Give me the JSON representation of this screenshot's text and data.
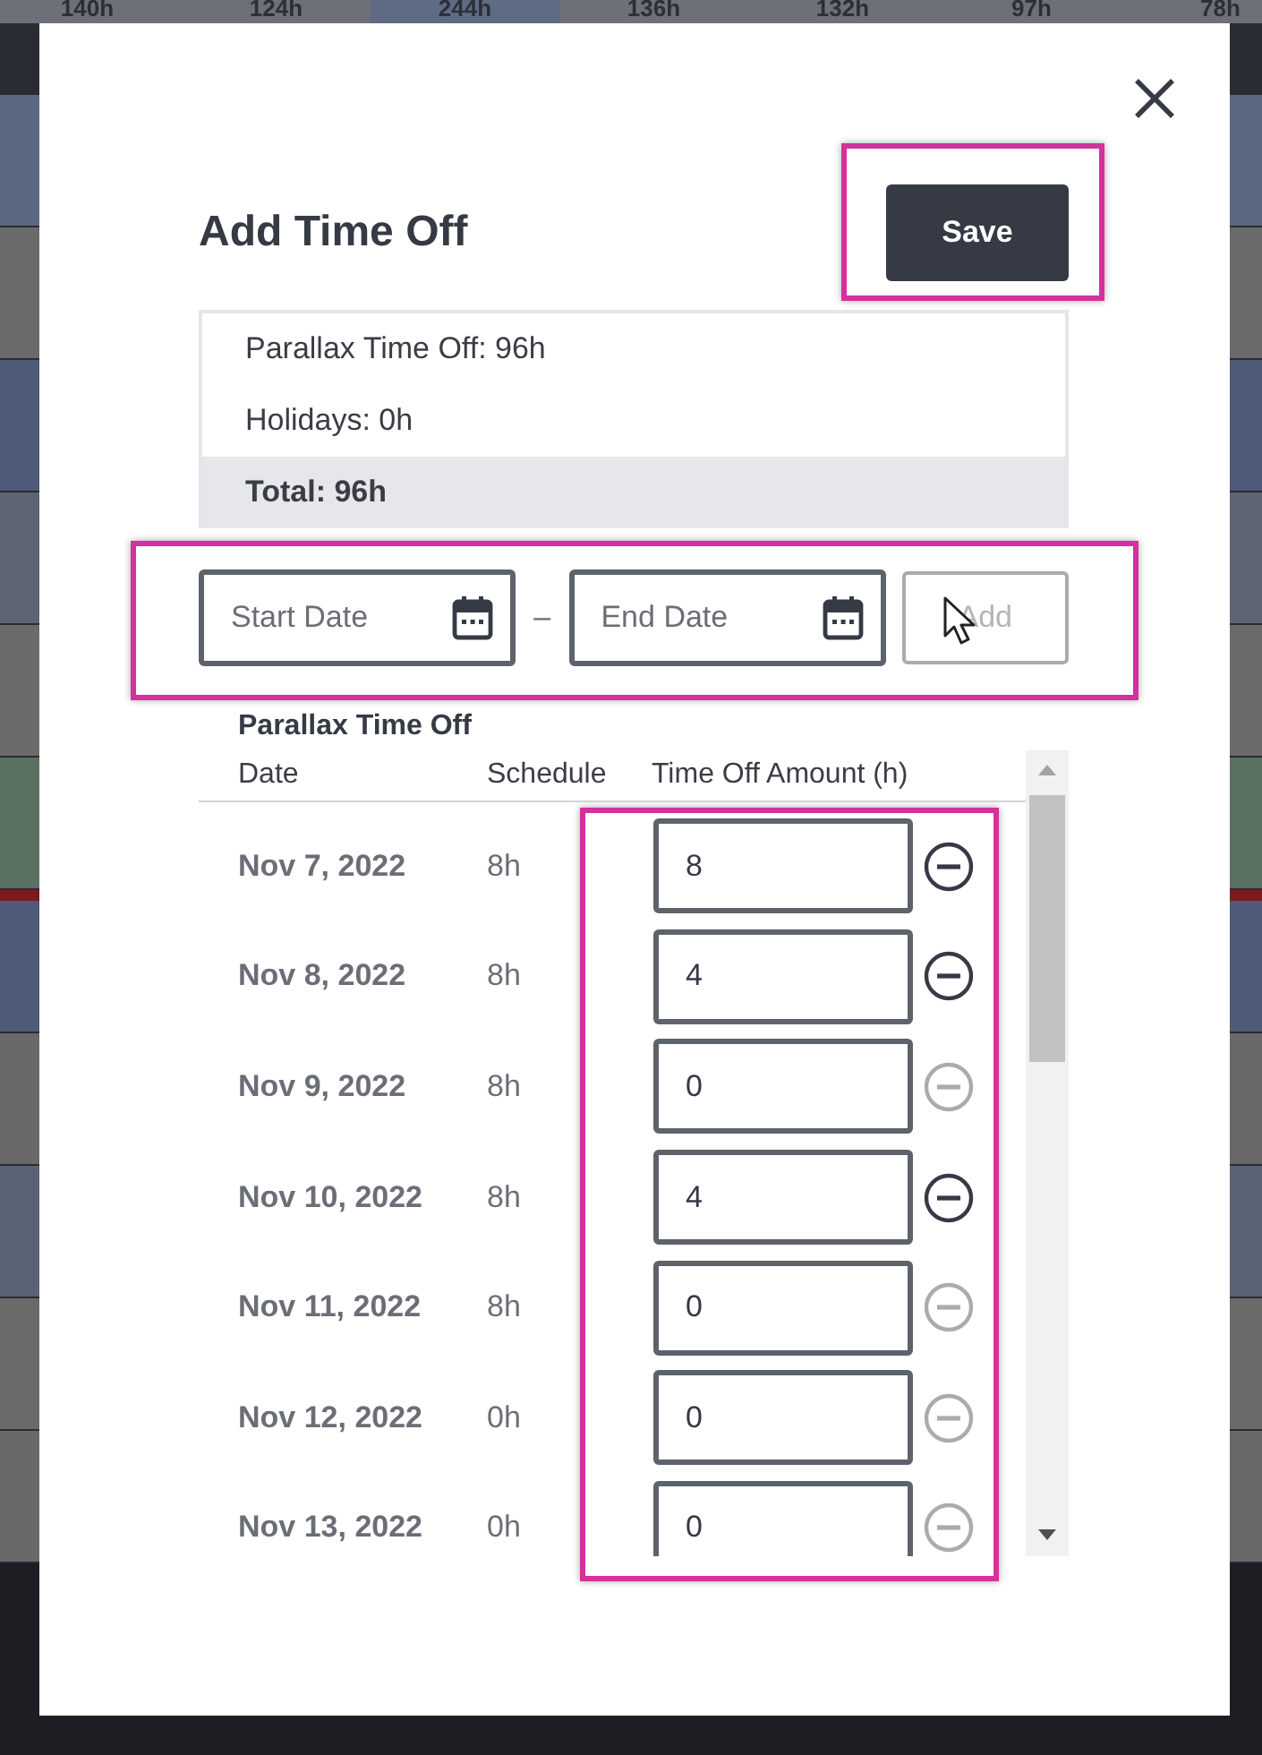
{
  "background": {
    "hour_totals": [
      {
        "label": "140h",
        "selected": false
      },
      {
        "label": "124h",
        "selected": false
      },
      {
        "label": "244h",
        "selected": true
      },
      {
        "label": "136h",
        "selected": false
      },
      {
        "label": "132h",
        "selected": false
      },
      {
        "label": "97h",
        "selected": false
      },
      {
        "label": "78h",
        "selected": false
      }
    ]
  },
  "dialog": {
    "title": "Add Time Off",
    "save_button": {
      "label": "Save",
      "highlighted": true
    },
    "summary": [
      {
        "label": "Parallax Time Off: 96h",
        "kind": "line"
      },
      {
        "label": "Holidays: 0h",
        "kind": "line"
      },
      {
        "label": "Total: 96h",
        "kind": "total"
      }
    ],
    "date_range": {
      "highlighted": true,
      "start": {
        "placeholder": "Start Date"
      },
      "separator": "–",
      "end": {
        "placeholder": "End Date"
      },
      "add_button": {
        "label": "Add",
        "disabled": true
      }
    },
    "table": {
      "title": "Parallax Time Off",
      "columns": [
        "Date",
        "Schedule",
        "Time Off Amount (h)"
      ],
      "amounts_highlighted": true,
      "rows": [
        {
          "date": "Nov 7, 2022",
          "schedule": "8h",
          "amount": "8",
          "remove_enabled": true
        },
        {
          "date": "Nov 8, 2022",
          "schedule": "8h",
          "amount": "4",
          "remove_enabled": true
        },
        {
          "date": "Nov 9, 2022",
          "schedule": "8h",
          "amount": "0",
          "remove_enabled": false
        },
        {
          "date": "Nov 10, 2022",
          "schedule": "8h",
          "amount": "4",
          "remove_enabled": true
        },
        {
          "date": "Nov 11, 2022",
          "schedule": "8h",
          "amount": "0",
          "remove_enabled": false
        },
        {
          "date": "Nov 12, 2022",
          "schedule": "0h",
          "amount": "0",
          "remove_enabled": false
        },
        {
          "date": "Nov 13, 2022",
          "schedule": "0h",
          "amount": "0",
          "remove_enabled": false
        }
      ]
    }
  }
}
